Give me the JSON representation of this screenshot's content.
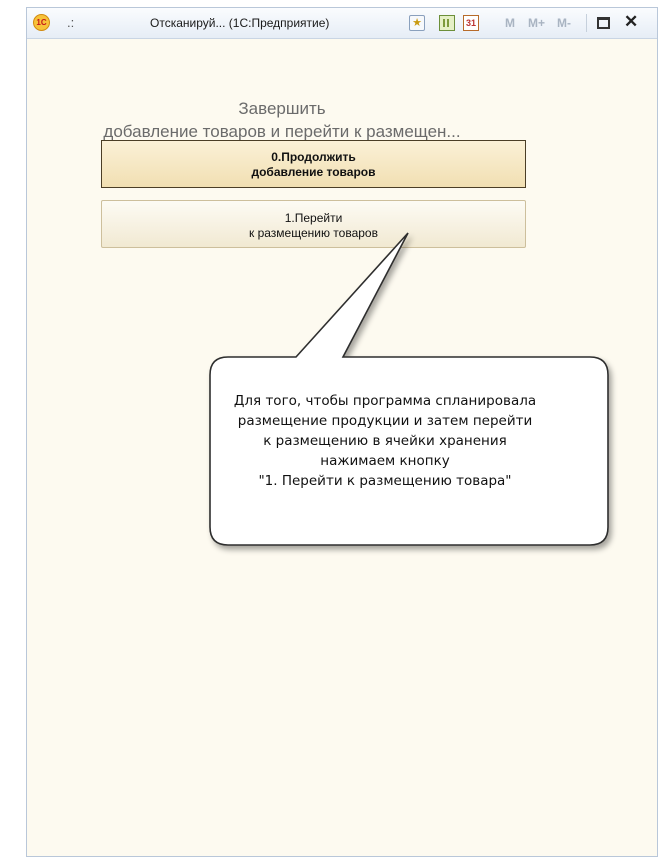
{
  "titlebar": {
    "logo_text": "1С",
    "menu_dots": ".:",
    "title": "Отсканируй... (1С:Предприятие)",
    "calendar_text": "31",
    "mem_buttons": [
      "M",
      "M+",
      "M-"
    ],
    "icons": [
      "favorites-icon",
      "calculator-icon",
      "calendar-icon",
      "maximize-icon",
      "close-icon"
    ]
  },
  "main": {
    "heading_line1": "Завершить",
    "heading_line2": "добавление товаров и перейти к размещен...",
    "button_continue_line1": "0.Продолжить",
    "button_continue_line2": "добавление товаров",
    "button_go_line1": "1.Перейти",
    "button_go_line2": "к размещению товаров"
  },
  "callout": {
    "lines": [
      "Для того, чтобы программа спланировала",
      "размещение продукции и затем перейти",
      "к размещению в ячейки хранения",
      "нажимаем кнопку",
      "\"1. Перейти к размещению товара\""
    ]
  },
  "colors": {
    "content_bg": "#fdfaf0",
    "button_continue_bg": "#f1dfb2",
    "heading_text": "#6b6b6b"
  }
}
